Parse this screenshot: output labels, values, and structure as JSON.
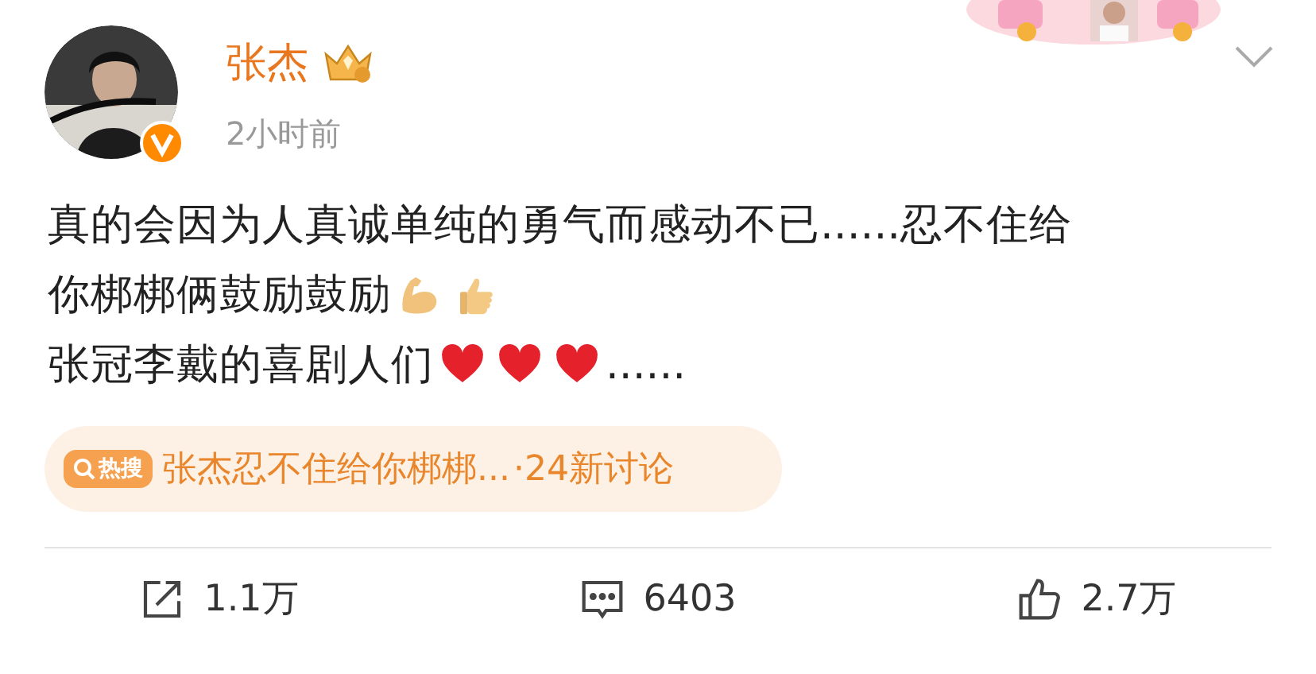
{
  "author": {
    "name": "张杰",
    "time": "2小时前"
  },
  "body": {
    "lines": [
      [
        {
          "kind": "text",
          "text": "真的会因为人真诚单纯的勇气而感动不已......忍不住给"
        }
      ],
      [
        {
          "kind": "text",
          "text": "你梆梆俩鼓励鼓励"
        },
        {
          "kind": "muscle"
        },
        {
          "kind": "thumb"
        }
      ],
      [
        {
          "kind": "text",
          "text": "张冠李戴的喜剧人们"
        },
        {
          "kind": "heart"
        },
        {
          "kind": "heart"
        },
        {
          "kind": "heart"
        },
        {
          "kind": "text",
          "text": "......"
        }
      ]
    ]
  },
  "hot_search": {
    "badge": "热搜",
    "title": "张杰忍不住给你梆梆...",
    "count": "·24新讨论"
  },
  "actions": [
    {
      "kind": "share",
      "label": "1.1万"
    },
    {
      "kind": "comment",
      "label": "6403"
    },
    {
      "kind": "like",
      "label": "2.7万"
    }
  ]
}
